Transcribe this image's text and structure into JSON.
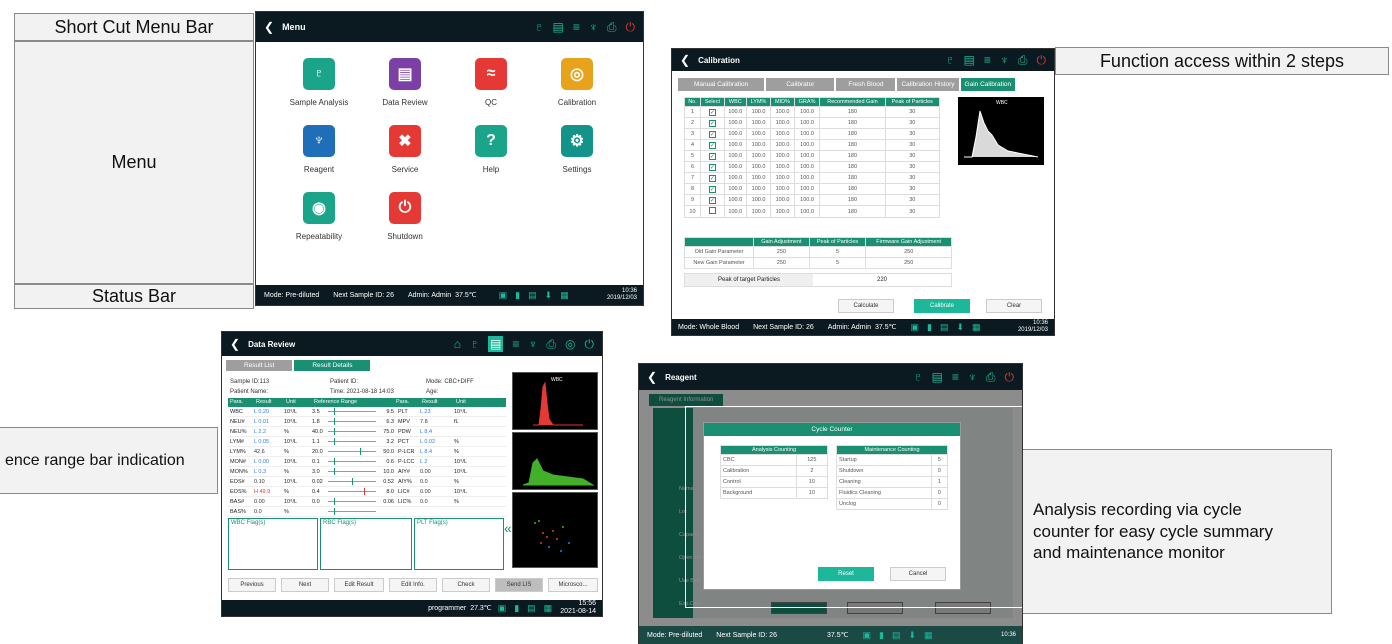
{
  "callouts": {
    "shortcut": "Short Cut Menu Bar",
    "menu": "Menu",
    "status": "Status Bar",
    "function_access": "Function access within 2 steps",
    "reference_range": "ence range bar indication",
    "analysis_l1": "Analysis recording via cycle",
    "analysis_l2": "counter for easy cycle summary",
    "analysis_l3": "and maintenance monitor"
  },
  "menu_screen": {
    "title": "Menu",
    "tiles": [
      {
        "label": "Sample Analysis",
        "color": "#1aa58a",
        "glyph": "e"
      },
      {
        "label": "Data Review",
        "color": "#7b3fa6",
        "glyph": "≡"
      },
      {
        "label": "QC",
        "color": "#e53935",
        "glyph": "≈"
      },
      {
        "label": "Calibration",
        "color": "#e8a31c",
        "glyph": "◎"
      },
      {
        "label": "Reagent",
        "color": "#1e6fb8",
        "glyph": "♆"
      },
      {
        "label": "Service",
        "color": "#e53935",
        "glyph": "✖"
      },
      {
        "label": "Help",
        "color": "#1aa58a",
        "glyph": "?"
      },
      {
        "label": "Settings",
        "color": "#13938a",
        "glyph": "⚙"
      },
      {
        "label": "Repeatability",
        "color": "#1aa58a",
        "glyph": "◉"
      },
      {
        "label": "Shutdown",
        "color": "#e53935",
        "glyph": "⏻"
      }
    ],
    "status": {
      "mode": "Mode: Pre-diluted",
      "next": "Next Sample ID: 26",
      "admin": "Admin: Admin",
      "temp": "37.5℃",
      "time": "10:36",
      "date": "2019/12/03"
    }
  },
  "calibration_screen": {
    "title": "Calibration",
    "tabs": [
      "Manual Calibration",
      "Calibrator",
      "Fresh Blood",
      "Calibration History",
      "Gain Calibration"
    ],
    "headers": [
      "No.",
      "Select",
      "WBC",
      "LYM%",
      "MID%",
      "GRA%",
      "Recommended Gain",
      "Peak of Particles"
    ],
    "rows": [
      [
        "1",
        "✓",
        "100.0",
        "100.0",
        "100.0",
        "100.0",
        "180",
        "30"
      ],
      [
        "2",
        "✓",
        "100.0",
        "100.0",
        "100.0",
        "100.0",
        "180",
        "30"
      ],
      [
        "3",
        "✓",
        "100.0",
        "100.0",
        "100.0",
        "100.0",
        "180",
        "30"
      ],
      [
        "4",
        "✓",
        "100.0",
        "100.0",
        "100.0",
        "100.0",
        "180",
        "30"
      ],
      [
        "5",
        "✓",
        "100.0",
        "100.0",
        "100.0",
        "100.0",
        "180",
        "30"
      ],
      [
        "6",
        "✓",
        "100.0",
        "100.0",
        "100.0",
        "100.0",
        "180",
        "30"
      ],
      [
        "7",
        "✓",
        "100.0",
        "100.0",
        "100.0",
        "100.0",
        "180",
        "30"
      ],
      [
        "8",
        "✓",
        "100.0",
        "100.0",
        "100.0",
        "100.0",
        "180",
        "30"
      ],
      [
        "9",
        "✓",
        "100.0",
        "100.0",
        "100.0",
        "100.0",
        "180",
        "30"
      ],
      [
        "10",
        "",
        "100.0",
        "100.0",
        "100.0",
        "100.0",
        "180",
        "30"
      ]
    ],
    "histogram_label": "WBC",
    "gain_headers": [
      "",
      "Gain Adjustment",
      "Peak of Particles",
      "Firmware Gain Adjustment"
    ],
    "gain_rows": [
      [
        "Old Gain Parameter",
        "250",
        "5",
        "250"
      ],
      [
        "New Gain Parameter",
        "250",
        "5",
        "250"
      ]
    ],
    "peak_label": "Peak of target Particles",
    "peak_value": "220",
    "buttons": {
      "calculate": "Calculate",
      "calibrate": "Calibrate",
      "clear": "Clear"
    },
    "status": {
      "mode": "Mode: Whole Blood",
      "next": "Next Sample ID: 26",
      "admin": "Admin: Admin",
      "temp": "37.5℃",
      "time": "10:36",
      "date": "2019/12/03"
    }
  },
  "data_review_screen": {
    "title": "Data Review",
    "tabs": [
      "Result List",
      "Result Details"
    ],
    "sample_id": "Sample ID:113",
    "patient_id": "Patient ID:",
    "mode": "Mode: CBC+DIFF",
    "patient_name": "Patient Name:",
    "time": "Time: 2021-08-18 14:03",
    "age": "Age:",
    "col_headers": {
      "para": "Para.",
      "result": "Result",
      "unit": "Unit",
      "range": "Reference Range"
    },
    "left_rows": [
      {
        "p": "WBC",
        "r": "L 0.20",
        "u": "10⁹/L",
        "lo": "3.5",
        "hi": "9.5"
      },
      {
        "p": "NEU#",
        "r": "L 0.01",
        "u": "10⁹/L",
        "lo": "1.8",
        "hi": "6.3"
      },
      {
        "p": "NEU%",
        "r": "L 2.2",
        "u": "%",
        "lo": "40.0",
        "hi": "75.0"
      },
      {
        "p": "LYM#",
        "r": "L 0.05",
        "u": "10⁹/L",
        "lo": "1.1",
        "hi": "3.2"
      },
      {
        "p": "LYM%",
        "r": "42.6",
        "u": "%",
        "lo": "20.0",
        "hi": "50.0"
      },
      {
        "p": "MON#",
        "r": "L 0.00",
        "u": "10⁹/L",
        "lo": "0.1",
        "hi": "0.6"
      },
      {
        "p": "MON%",
        "r": "L 0.3",
        "u": "%",
        "lo": "3.0",
        "hi": "10.0"
      },
      {
        "p": "EOS#",
        "r": "0.10",
        "u": "10⁹/L",
        "lo": "0.02",
        "hi": "0.52"
      },
      {
        "p": "EOS%",
        "r": "H 49.9",
        "u": "%",
        "lo": "0.4",
        "hi": "8.0"
      },
      {
        "p": "BAS#",
        "r": "0.00",
        "u": "10⁹/L",
        "lo": "0.0",
        "hi": "0.06"
      },
      {
        "p": "BAS%",
        "r": "0.0",
        "u": "%",
        "lo": "",
        "hi": ""
      }
    ],
    "right_rows": [
      {
        "p": "PLT",
        "r": "L 23",
        "u": "10⁹/L"
      },
      {
        "p": "MPV",
        "r": "7.8",
        "u": "fL"
      },
      {
        "p": "PDW",
        "r": "L 8.4",
        "u": ""
      },
      {
        "p": "PCT",
        "r": "L 0.02",
        "u": "%"
      },
      {
        "p": "P-LCR",
        "r": "L 8.4",
        "u": "%"
      },
      {
        "p": "P-LCC",
        "r": "L 2",
        "u": "10⁹/L"
      },
      {
        "p": "AIY#",
        "r": "0.00",
        "u": "10⁹/L"
      },
      {
        "p": "AIY%",
        "r": "0.0",
        "u": "%"
      },
      {
        "p": "LIC#",
        "r": "0.00",
        "u": "10⁹/L"
      },
      {
        "p": "LIC%",
        "r": "0.0",
        "u": "%"
      }
    ],
    "flags": [
      "WBC Flag(s)",
      "RBC Flag(s)",
      "PLT Flag(s)"
    ],
    "buttons": [
      "Previous",
      "Next",
      "Edit Result",
      "Edit Info.",
      "Check",
      "Send LIS",
      "Microsco..."
    ],
    "status": {
      "user": "programmer",
      "temp": "27.3℃",
      "time": "15:56",
      "date": "2021-08-14"
    }
  },
  "reagent_screen": {
    "title": "Reagent",
    "tab": "Reagent Information",
    "side_labels": [
      "Name",
      "Lot",
      "Capacity",
      "Open Da",
      "Use Befo",
      "Exp.Date"
    ],
    "dialog_title": "Cycle Counter",
    "left_head": "Analysis Counting",
    "right_head": "Maintenance Counting",
    "left_rows": [
      [
        "CBC",
        "125"
      ],
      [
        "Calibration",
        "2"
      ],
      [
        "Control",
        "10"
      ],
      [
        "Background",
        "10"
      ]
    ],
    "right_rows": [
      [
        "Startup",
        "5"
      ],
      [
        "Shutdown",
        "0"
      ],
      [
        "Cleaning",
        "1"
      ],
      [
        "Fluidics Cleaning",
        "0"
      ],
      [
        "Unclog",
        "0"
      ]
    ],
    "reset": "Reset",
    "cancel": "Cancel",
    "under_buttons": [
      "",
      "",
      ""
    ],
    "status": {
      "mode": "Mode: Pre-diluted",
      "next": "Next Sample ID: 26",
      "temp": "37.5℃",
      "time": "10:36"
    }
  }
}
